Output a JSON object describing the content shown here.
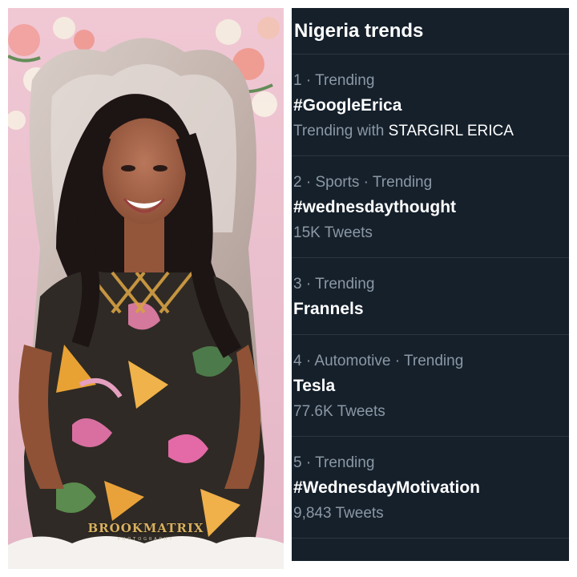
{
  "photo": {
    "watermark": "BROOKMATRIX",
    "watermark_sub": "PHOTOGRAPHY"
  },
  "panel": {
    "title": "Nigeria trends",
    "trends": [
      {
        "meta": "1 · Trending",
        "name": "#GoogleErica",
        "sub_prefix": "Trending with ",
        "sub_highlight": "STARGIRL ERICA"
      },
      {
        "meta": "2 · Sports · Trending",
        "name": "#wednesdaythought",
        "sub": "15K Tweets"
      },
      {
        "meta": "3 · Trending",
        "name": "Frannels"
      },
      {
        "meta": "4 · Automotive · Trending",
        "name": "Tesla",
        "sub": "77.6K Tweets"
      },
      {
        "meta": "5 · Trending",
        "name": "#WednesdayMotivation",
        "sub": "9,843 Tweets"
      }
    ]
  },
  "colors": {
    "panel_bg": "#15202b",
    "text_primary": "#ffffff",
    "text_secondary": "#8b98a5"
  }
}
